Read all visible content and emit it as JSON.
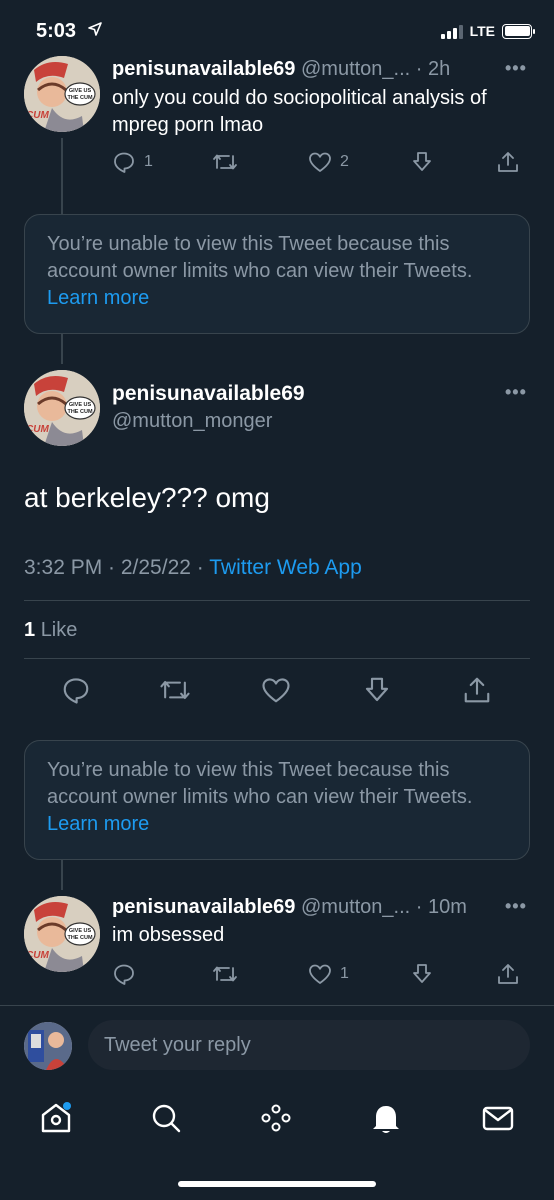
{
  "status_bar": {
    "time": "5:03",
    "network": "LTE"
  },
  "tweets": [
    {
      "display_name": "penisunavailable69",
      "handle": "@mutton_...",
      "time": "· 2h",
      "text": "only you could do sociopolitical analysis of mpreg porn lmao",
      "reply_count": "1",
      "retweet_count": "",
      "like_count": "2"
    },
    {
      "display_name": "penisunavailable69",
      "handle": "@mutton_...",
      "time": "· 10m",
      "text": "im obsessed",
      "reply_count": "",
      "retweet_count": "",
      "like_count": "1"
    }
  ],
  "restricted_notice": {
    "text": "You’re unable to view this Tweet because this account owner limits who can view their Tweets.",
    "link": "Learn more"
  },
  "main_tweet": {
    "display_name": "penisunavailable69",
    "handle": "@mutton_monger",
    "text": "at berkeley??? omg",
    "timestamp": "3:32 PM · 2/25/22 ·",
    "source": "Twitter Web App",
    "likes_count": "1",
    "likes_label": "Like"
  },
  "avatar_sticker": {
    "line1": "GIVE US",
    "line2": "THE CUM",
    "tag": "CUM"
  },
  "reply_bar": {
    "placeholder": "Tweet your reply"
  },
  "more_glyph": "•••",
  "colors": {
    "background": "#15202b",
    "accent": "#1d9bf0",
    "muted": "#8b98a5",
    "border": "#38444d"
  },
  "icons": [
    "reply-icon",
    "retweet-icon",
    "like-icon",
    "download-icon",
    "share-icon",
    "home-icon",
    "search-icon",
    "spaces-icon",
    "notifications-icon",
    "messages-icon"
  ]
}
